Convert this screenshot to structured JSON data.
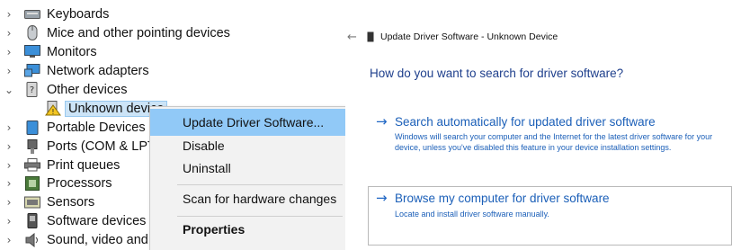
{
  "device_tree": {
    "items": [
      {
        "label": "Keyboards",
        "icon": "keyboard-icon",
        "expanded": false
      },
      {
        "label": "Mice and other pointing devices",
        "icon": "mouse-icon",
        "expanded": false
      },
      {
        "label": "Monitors",
        "icon": "monitor-icon",
        "expanded": false
      },
      {
        "label": "Network adapters",
        "icon": "network-adapter-icon",
        "expanded": false
      },
      {
        "label": "Other devices",
        "icon": "unknown-device-category-icon",
        "expanded": true
      },
      {
        "label": "Unknown device",
        "icon": "warning-device-icon",
        "child": true,
        "selected": true
      },
      {
        "label": "Portable Devices",
        "icon": "portable-device-icon",
        "expanded": false
      },
      {
        "label": "Ports (COM & LPT)",
        "icon": "port-icon",
        "expanded": false
      },
      {
        "label": "Print queues",
        "icon": "printer-icon",
        "expanded": false
      },
      {
        "label": "Processors",
        "icon": "processor-icon",
        "expanded": false
      },
      {
        "label": "Sensors",
        "icon": "sensor-icon",
        "expanded": false
      },
      {
        "label": "Software devices",
        "icon": "software-device-icon",
        "expanded": false
      },
      {
        "label": "Sound, video and game controllers",
        "icon": "speaker-icon",
        "expanded": false
      }
    ],
    "chevron_collapsed": "›",
    "chevron_expanded": "⌄"
  },
  "context_menu": {
    "items": [
      {
        "label": "Update Driver Software...",
        "highlighted": true
      },
      {
        "label": "Disable"
      },
      {
        "label": "Uninstall"
      },
      {
        "label": "Scan for hardware changes"
      },
      {
        "label": "Properties",
        "bold": true
      }
    ],
    "highlight_color": "#91c9f7"
  },
  "wizard": {
    "back_glyph": "←",
    "title": "Update Driver Software - Unknown Device",
    "question": "How do you want to search for driver software?",
    "options": [
      {
        "arrow": "→",
        "title": "Search automatically for updated driver software",
        "description": "Windows will search your computer and the Internet for the latest driver software for your device, unless you've disabled this feature in your device installation settings."
      },
      {
        "arrow": "→",
        "title": "Browse my computer for driver software",
        "description": "Locate and install driver software manually."
      }
    ],
    "link_color": "#1b5fb8",
    "heading_color": "#1e3f8c"
  }
}
